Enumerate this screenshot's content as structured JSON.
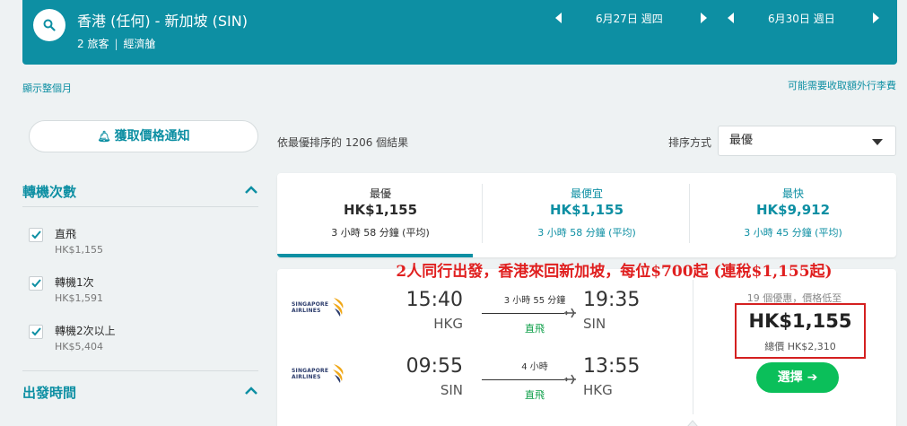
{
  "search": {
    "route": "香港 (任何) - 新加坡 (SIN)",
    "travelers": "2 旅客",
    "cabin": "經濟艙",
    "depart_date": "6月27日 週四",
    "return_date": "6月30日 週日"
  },
  "links": {
    "show_month": "顯示整個月",
    "baggage_fees": "可能需要收取額外行李費"
  },
  "alert_button": "獲取價格通知",
  "filters": {
    "stops_title": "轉機次數",
    "stops": [
      {
        "label": "直飛",
        "price": "HK$1,155",
        "checked": true
      },
      {
        "label": "轉機1次",
        "price": "HK$1,591",
        "checked": true
      },
      {
        "label": "轉機2次以上",
        "price": "HK$5,404",
        "checked": true
      }
    ],
    "departure_title": "出發時間"
  },
  "results": {
    "count_text": "依最優排序的 1206 個結果",
    "sort_label": "排序方式",
    "sort_value": "最優"
  },
  "tabs": [
    {
      "name": "最優",
      "price": "HK$1,155",
      "duration": "3 小時 58 分鐘 (平均)",
      "active": true
    },
    {
      "name": "最便宜",
      "price": "HK$1,155",
      "duration": "3 小時 58 分鐘 (平均)",
      "active": false
    },
    {
      "name": "最快",
      "price": "HK$9,912",
      "duration": "3 小時 45 分鐘 (平均)",
      "active": false
    }
  ],
  "promo_text": "2人同行出發，香港來回新加坡，每位$700起 (連稅$1,155起)",
  "flight": {
    "legs": [
      {
        "airline_line1": "SINGAPORE",
        "airline_line2": "AIRLINES",
        "dep_time": "15:40",
        "dep_code": "HKG",
        "duration": "3 小時 55 分鐘",
        "stops": "直飛",
        "arr_time": "19:35",
        "arr_code": "SIN"
      },
      {
        "airline_line1": "SINGAPORE",
        "airline_line2": "AIRLINES",
        "dep_time": "09:55",
        "dep_code": "SIN",
        "duration": "4 小時",
        "stops": "直飛",
        "arr_time": "13:55",
        "arr_code": "HKG"
      }
    ],
    "deals_text": "19 個優惠，價格低至",
    "price": "HK$1,155",
    "total": "總價 HK$2,310",
    "select_label": "選擇"
  },
  "colors": {
    "brand": "#0d8fa3",
    "select_button": "#0bbf5a",
    "promo_red": "#e02020",
    "highlight_box": "#d42020"
  }
}
